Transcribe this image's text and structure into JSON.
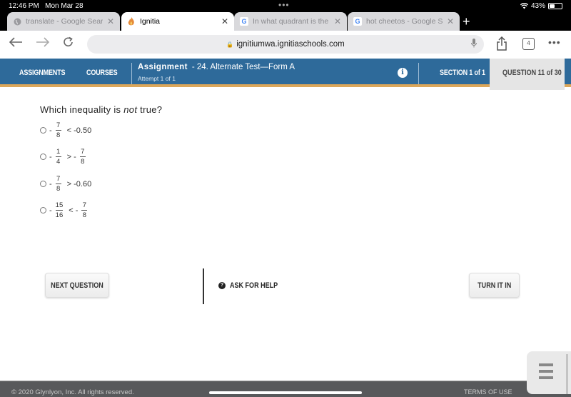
{
  "status_bar": {
    "time": "12:46 PM",
    "date": "Mon Mar 28",
    "battery": "43%",
    "battery_level": 0.43,
    "wifi_icon": "wifi-icon"
  },
  "browser": {
    "tabs": [
      {
        "title": "translate - Google Search",
        "icon": "globe-icon",
        "active": false
      },
      {
        "title": "Ignitia",
        "icon": "flame-icon",
        "active": true
      },
      {
        "title": "In what quadrant is the origin",
        "icon": "google-icon",
        "active": false
      },
      {
        "title": "hot cheetos - Google Search",
        "icon": "google-icon",
        "active": false
      }
    ],
    "new_tab": "+",
    "url": "ignitiumwa.ignitiaschools.com",
    "tab_count": "4",
    "more": "•••",
    "back": "←",
    "forward": "→",
    "reload": "↻"
  },
  "app_nav": {
    "assignments": "ASSIGNMENTS",
    "courses": "COURSES",
    "assignment_label": "Assignment",
    "assignment_name": "- 24. Alternate Test—Form A",
    "attempt": "Attempt 1 of 1",
    "info": "i",
    "section": "SECTION 1 of 1",
    "question": "QUESTION 11 of 30"
  },
  "question": {
    "prefix": "Which inequality is ",
    "emphasis": "not",
    "suffix": " true?",
    "options": [
      {
        "lhs_sign": "-",
        "lhs_num": "7",
        "lhs_den": "8",
        "op": "<",
        "rhs": "-0.50"
      },
      {
        "lhs_sign": "-",
        "lhs_num": "1",
        "lhs_den": "4",
        "op": ">",
        "rhs_sign": "-",
        "rhs_num": "7",
        "rhs_den": "8"
      },
      {
        "lhs_sign": "-",
        "lhs_num": "7",
        "lhs_den": "8",
        "op": ">",
        "rhs": "-0.60"
      },
      {
        "lhs_sign": "-",
        "lhs_num": "15",
        "lhs_den": "16",
        "op": "<",
        "rhs_sign": "-",
        "rhs_num": "7",
        "rhs_den": "8"
      }
    ]
  },
  "actions": {
    "next": "NEXT QUESTION",
    "help": "ASK FOR HELP",
    "turn_in": "TURN IT IN"
  },
  "footer": {
    "copyright": "© 2020 Glynlyon, Inc. All rights reserved.",
    "terms": "TERMS OF USE"
  },
  "colors": {
    "nav_blue": "#2e6a9a",
    "accent_gold": "#dca75a",
    "footer_gray": "#58595b"
  }
}
